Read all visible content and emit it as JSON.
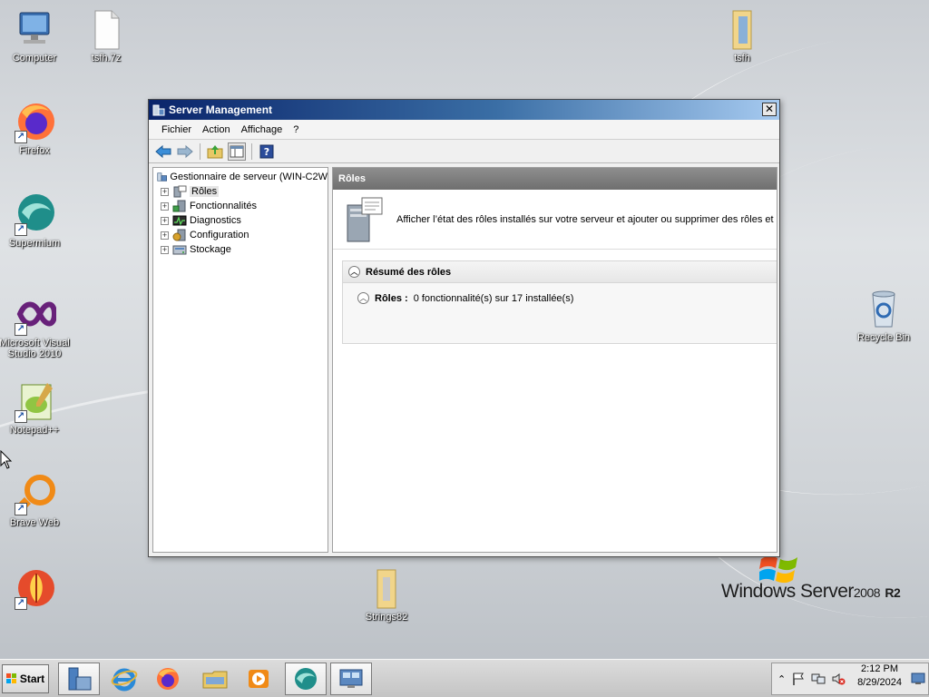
{
  "desktop": {
    "icons": [
      {
        "label": "Computer"
      },
      {
        "label": "tsfh.7z"
      },
      {
        "label": "tsfh"
      },
      {
        "label": "Firefox"
      },
      {
        "label": "Supermium"
      },
      {
        "label": "Microsoft Visual Studio 2010"
      },
      {
        "label": "Notepad++"
      },
      {
        "label": "Brave Web"
      },
      {
        "label": ""
      },
      {
        "label": "Recycle Bin"
      },
      {
        "label": "Strings82"
      }
    ]
  },
  "window": {
    "title": "Server Management",
    "menu": [
      "Fichier",
      "Action",
      "Affichage",
      "?"
    ],
    "toolbar_icons": [
      "back-icon",
      "forward-icon",
      "up-folder-icon",
      "show-hide-console-tree-icon",
      "help-icon"
    ],
    "tree": {
      "root": "Gestionnaire de serveur (WIN-C2W",
      "items": [
        {
          "label": "Rôles",
          "icon": "roles-icon"
        },
        {
          "label": "Fonctionnalités",
          "icon": "features-icon"
        },
        {
          "label": "Diagnostics",
          "icon": "diagnostics-icon"
        },
        {
          "label": "Configuration",
          "icon": "configuration-icon"
        },
        {
          "label": "Stockage",
          "icon": "storage-icon"
        }
      ]
    },
    "detail": {
      "header": "Rôles",
      "intro": "Afficher l’état des rôles installés sur votre serveur et ajouter ou supprimer des rôles et",
      "summary_title": "Résumé des rôles",
      "roles_label": "Rôles :",
      "roles_value": "0 fonctionnalité(s) sur 17 installée(s)"
    }
  },
  "branding": {
    "windows": "Windows Server",
    "version": "2008",
    "release": "R2"
  },
  "taskbar": {
    "start_label": "Start",
    "apps": [
      "server-manager-icon",
      "internet-explorer-icon",
      "firefox-icon",
      "file-explorer-icon",
      "media-player-icon",
      "supermium-icon",
      "remote-desktop-icon"
    ],
    "time": "2:12 PM",
    "date": "8/29/2024"
  },
  "colors": {
    "titlebar_start": "#0a246a",
    "titlebar_end": "#a6caf0",
    "detail_header": "#7f7f7f"
  }
}
